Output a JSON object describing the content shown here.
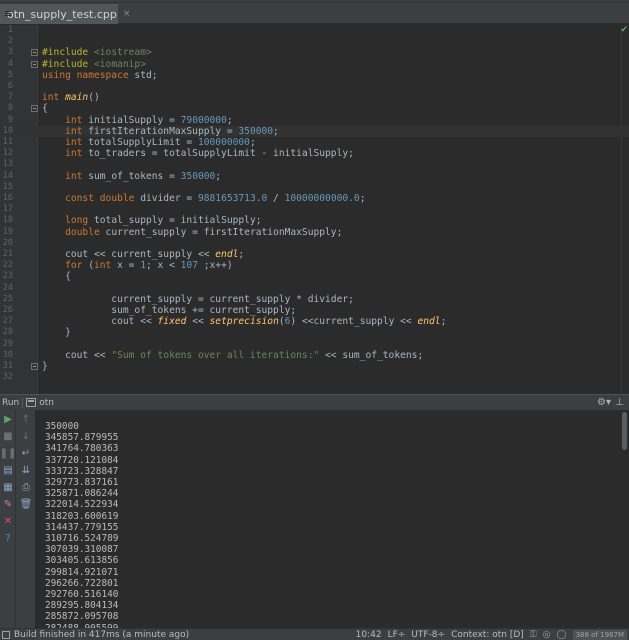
{
  "tab": {
    "label": "otn_supply_test.cpp",
    "close": "×"
  },
  "editor": {
    "line_numbers": [
      "1",
      "2",
      "3",
      "4",
      "5",
      "6",
      "7",
      "8",
      "9",
      "10",
      "11",
      "12",
      "13",
      "14",
      "15",
      "16",
      "17",
      "18",
      "19",
      "20",
      "21",
      "22",
      "23",
      "24",
      "25",
      "26",
      "27",
      "28",
      "29",
      "30",
      "31",
      "32"
    ]
  },
  "run": {
    "title": "Run",
    "config": "otn"
  },
  "console": {
    "output": [
      "350000",
      "345857.879955",
      "341764.780363",
      "337720.121084",
      "333723.328847",
      "329773.837161",
      "325871.086244",
      "322014.522934",
      "318203.600619",
      "314437.779155",
      "310716.524789",
      "307039.310087",
      "303405.613856",
      "299814.921071",
      "296266.722801",
      "292760.516140",
      "289295.804134",
      "285872.095708",
      "282488.905599"
    ]
  },
  "status": {
    "message": "Build finished in 417ms (a minute ago)",
    "position": "10:42",
    "line_sep": "LF÷",
    "encoding": "UTF-8÷",
    "context": "Context: otn [D]",
    "memory": "388 of 1987M"
  }
}
